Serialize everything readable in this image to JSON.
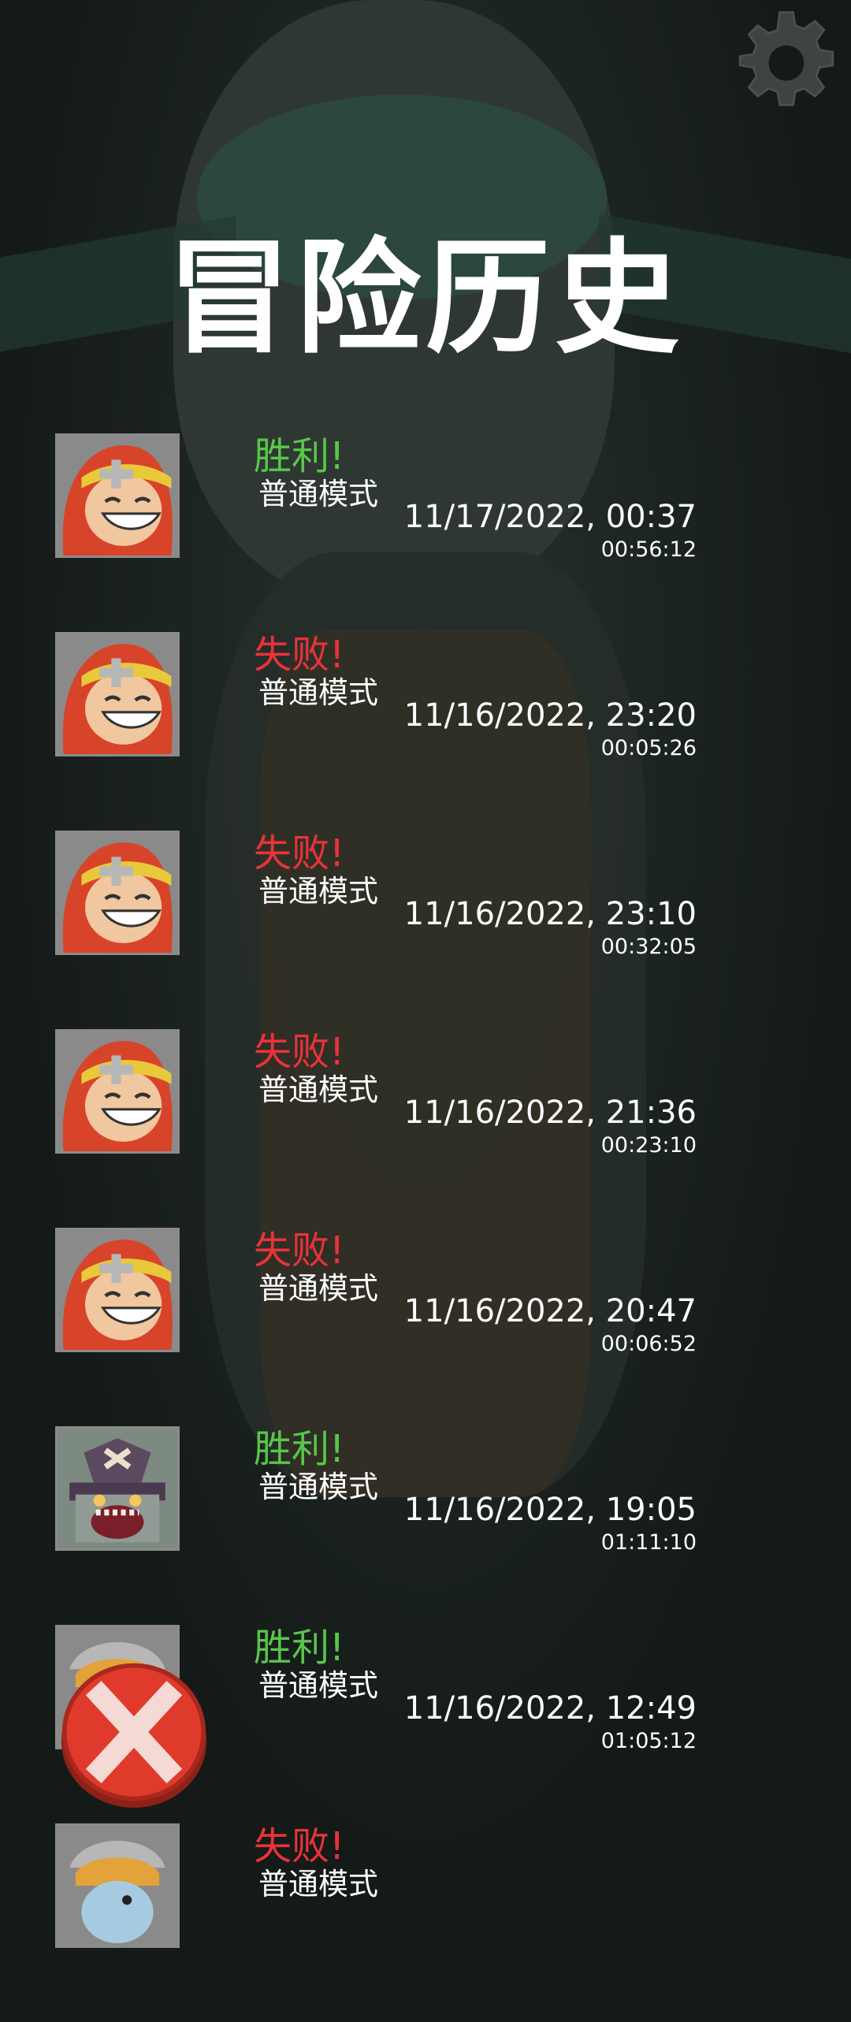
{
  "title": "冒险历史",
  "icons": {
    "settings": "gear-icon",
    "close": "close-icon"
  },
  "colors": {
    "win": "#59c64a",
    "lose": "#e8333a",
    "close_button": "#e03a2c"
  },
  "history": [
    {
      "result": "胜利!",
      "outcome": "win",
      "mode": "普通模式",
      "date": "11/17/2022, 00:37",
      "duration": "00:56:12",
      "hero": "red-hair-girl"
    },
    {
      "result": "失败!",
      "outcome": "lose",
      "mode": "普通模式",
      "date": "11/16/2022, 23:20",
      "duration": "00:05:26",
      "hero": "red-hair-girl"
    },
    {
      "result": "失败!",
      "outcome": "lose",
      "mode": "普通模式",
      "date": "11/16/2022, 23:10",
      "duration": "00:32:05",
      "hero": "red-hair-girl"
    },
    {
      "result": "失败!",
      "outcome": "lose",
      "mode": "普通模式",
      "date": "11/16/2022, 21:36",
      "duration": "00:23:10",
      "hero": "red-hair-girl"
    },
    {
      "result": "失败!",
      "outcome": "lose",
      "mode": "普通模式",
      "date": "11/16/2022, 20:47",
      "duration": "00:06:52",
      "hero": "red-hair-girl"
    },
    {
      "result": "胜利!",
      "outcome": "win",
      "mode": "普通模式",
      "date": "11/16/2022, 19:05",
      "duration": "01:11:10",
      "hero": "pirate-zombie"
    },
    {
      "result": "胜利!",
      "outcome": "win",
      "mode": "普通模式",
      "date": "11/16/2022, 12:49",
      "duration": "01:05:12",
      "hero": "blonde-boy"
    },
    {
      "result": "失败!",
      "outcome": "lose",
      "mode": "普通模式",
      "date": "",
      "duration": "",
      "hero": "blonde-boy"
    }
  ]
}
